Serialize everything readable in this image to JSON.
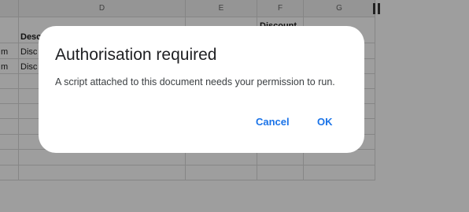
{
  "sheet": {
    "columns": [
      "D",
      "E",
      "F",
      "G"
    ],
    "cells": {
      "f_header_partial": "Discount",
      "d_header_partial": "Desc",
      "row1_left": "m",
      "row1_d": "Disc",
      "row2_left": "m",
      "row2_d": "Disc"
    }
  },
  "dialog": {
    "title": "Authorisation required",
    "message": "A script attached to this document needs your permission to run.",
    "cancel_label": "Cancel",
    "ok_label": "OK"
  },
  "colors": {
    "accent": "#1a73e8",
    "overlay": "#9e9e9e",
    "dialog_bg": "#ffffff"
  }
}
